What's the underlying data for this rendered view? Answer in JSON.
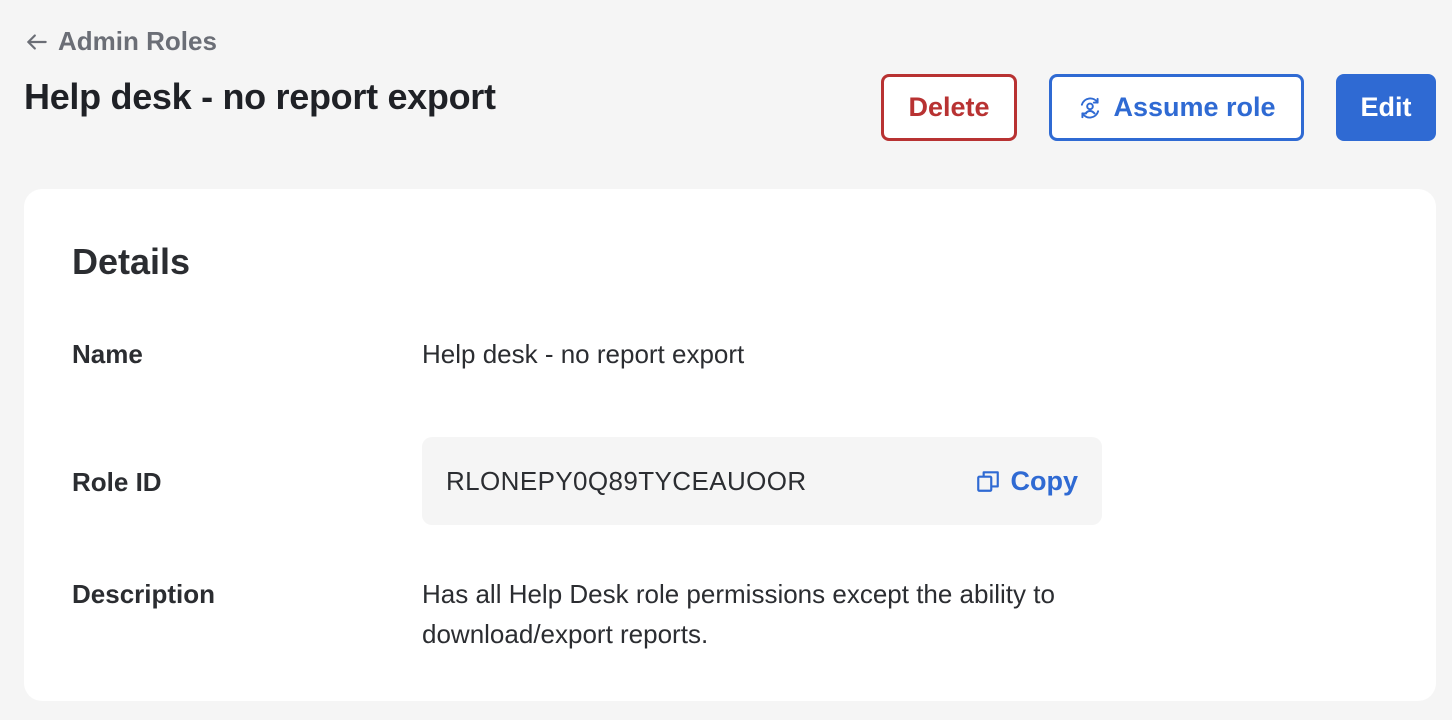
{
  "header": {
    "back_label": "Admin Roles",
    "title": "Help desk - no report export"
  },
  "actions": {
    "delete_label": "Delete",
    "assume_label": "Assume role",
    "edit_label": "Edit"
  },
  "details": {
    "title": "Details",
    "fields": {
      "name": {
        "label": "Name",
        "value": "Help desk - no report export"
      },
      "role_id": {
        "label": "Role ID",
        "value": "RLONEPY0Q89TYCEAUOOR",
        "copy_label": "Copy"
      },
      "description": {
        "label": "Description",
        "value": "Has all Help Desk role permissions except the ability to download/export reports."
      }
    }
  },
  "icons": {
    "back": "arrow-left-icon",
    "assume": "user-switch-icon",
    "copy": "copy-icon"
  },
  "colors": {
    "primary": "#2f6ad3",
    "danger": "#b83232",
    "background": "#f5f5f5",
    "card": "#ffffff",
    "text": "#2b2d31",
    "muted": "#6b6e76"
  }
}
